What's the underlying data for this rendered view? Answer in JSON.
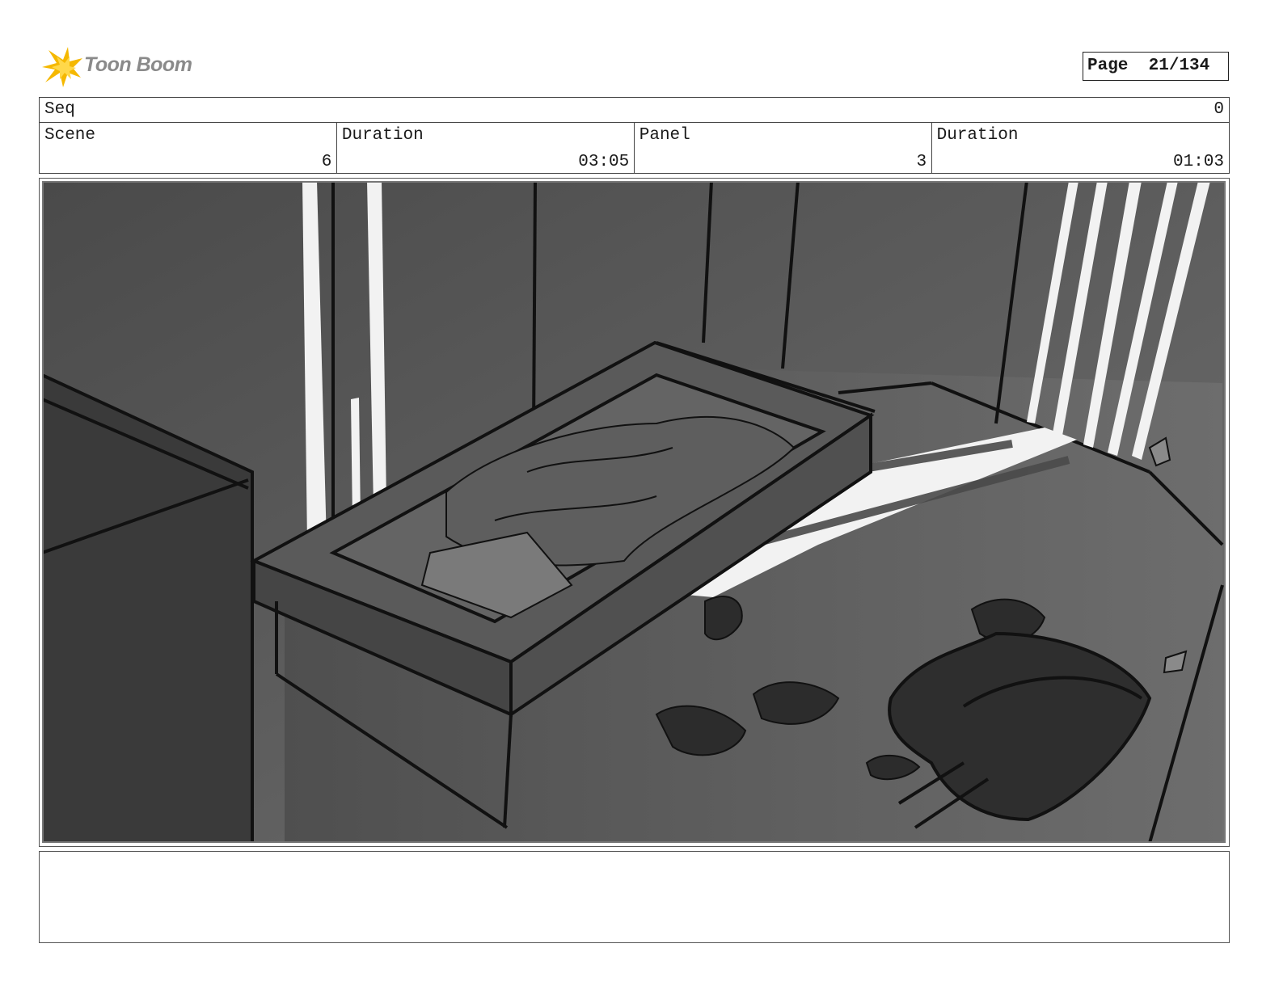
{
  "header": {
    "logo_text": "Toon Boom",
    "page_label": "Page",
    "page_value": "21/134"
  },
  "info": {
    "seq_label": "Seq",
    "seq_value": "0",
    "scene_label": "Scene",
    "scene_value": "6",
    "scene_duration_label": "Duration",
    "scene_duration_value": "03:05",
    "panel_label": "Panel",
    "panel_value": "3",
    "panel_duration_label": "Duration",
    "panel_duration_value": "01:03"
  },
  "colors": {
    "logo_accent": "#f5b800",
    "sketch_dark": "#3a3a3a",
    "sketch_light": "#6a6a6a"
  },
  "notes": {
    "text": ""
  }
}
